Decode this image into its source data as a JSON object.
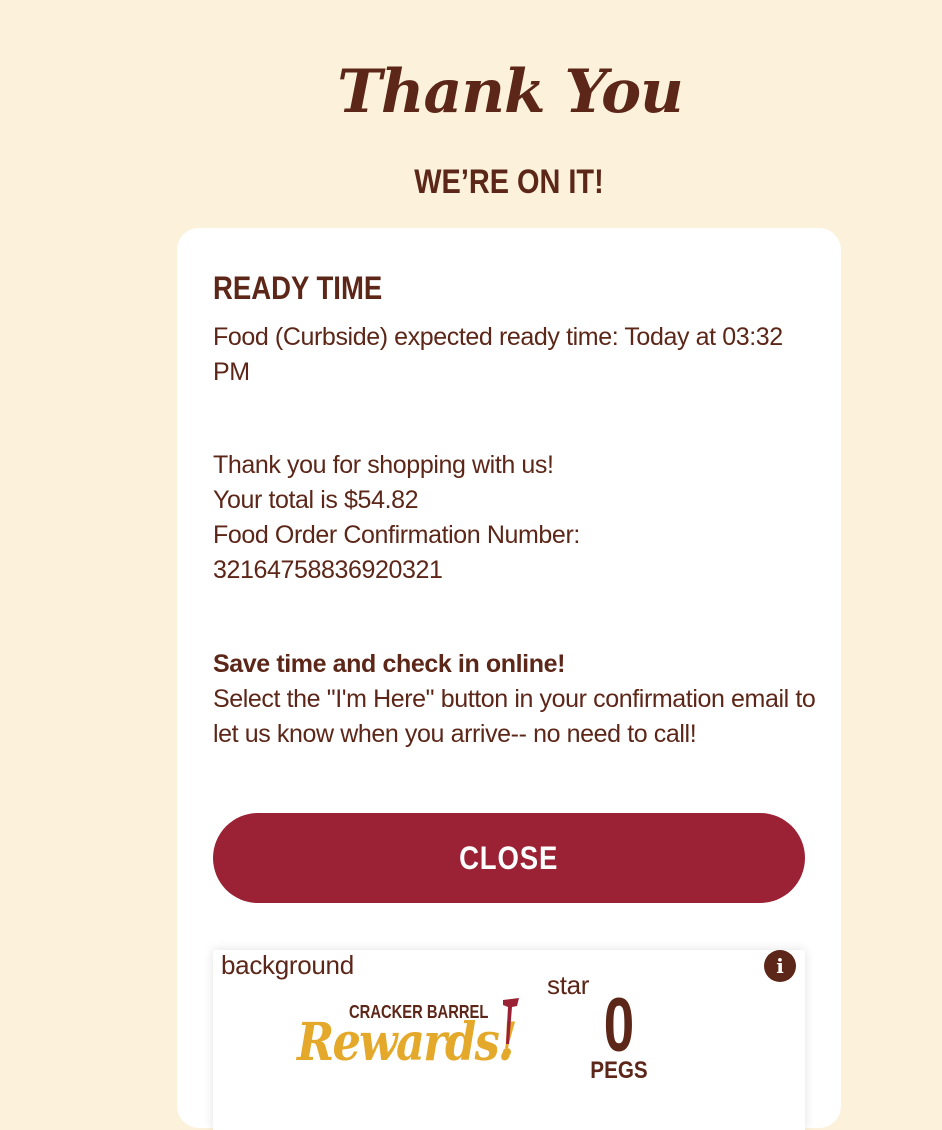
{
  "header": {
    "title": "Thank You",
    "subtitle": "WE’RE ON IT!"
  },
  "ready_time": {
    "heading": "READY TIME",
    "text": "Food (Curbside) expected ready time: Today at 03:32 PM"
  },
  "order": {
    "thanks": "Thank you for shopping with us!",
    "total": "Your total is $54.82",
    "confirmation_label": "Food Order Confirmation Number:",
    "confirmation_number": "32164758836920321"
  },
  "checkin": {
    "heading": "Save time and check in online!",
    "text": "Select the \"I'm Here\" button in your confirmation email to let us know when you arrive-- no need to call!"
  },
  "actions": {
    "close_label": "CLOSE"
  },
  "rewards": {
    "background_alt": "background",
    "star_alt": "star",
    "logo_top": "CRACKER BARREL",
    "logo_script": "Rewards!",
    "pegs_count": "0",
    "pegs_label": "PEGS",
    "info_icon": "info-icon"
  },
  "colors": {
    "page_background": "#fcf2dc",
    "brown_text": "#5c2618",
    "close_button": "#9b2235",
    "rewards_gold": "#e4a92a"
  }
}
